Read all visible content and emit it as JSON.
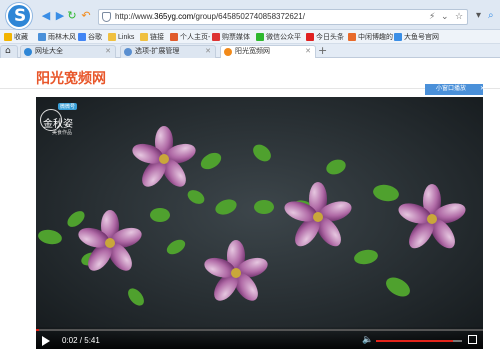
{
  "browser": {
    "url_prefix": "http://www.",
    "url_host": "365yg.com",
    "url_path": "/group/6458502740858372621/",
    "bookmarks": [
      {
        "label": "收藏",
        "color": "#f2b400"
      },
      {
        "label": "雨林木风",
        "color": "#4a90d9"
      },
      {
        "label": "谷歌",
        "color": "#4285f4"
      },
      {
        "label": "Links",
        "color": "#f0c040"
      },
      {
        "label": "链接",
        "color": "#f0c040"
      },
      {
        "label": "个人主页-",
        "color": "#e05a2b"
      },
      {
        "label": "购票媒体",
        "color": "#d33"
      },
      {
        "label": "微信公众平",
        "color": "#2eb82e"
      },
      {
        "label": "今日头条",
        "color": "#e02020"
      },
      {
        "label": "中闲博趣的",
        "color": "#e86a2a"
      },
      {
        "label": "大鱼号官网",
        "color": "#3a8ee6"
      }
    ],
    "tabs": [
      {
        "label": "网址大全",
        "fav": "#2e86d6",
        "active": false
      },
      {
        "label": "选项-扩展管理",
        "fav": "#5a8fd0",
        "active": false
      },
      {
        "label": "阳光宽频网",
        "fav": "#f28a1a",
        "active": true
      }
    ],
    "new_tab": "+"
  },
  "site": {
    "logo_text": "阳光宽频网",
    "mini_player_label": "小窗口播放",
    "mini_close": "✕"
  },
  "video": {
    "channel_badge": "微微号",
    "channel_name": "金秋姿",
    "channel_sub": "美食作品",
    "current_time": "0:02",
    "duration": "5:41",
    "time_sep": " / ",
    "progress_fraction": 0.006,
    "volume_fraction": 0.9,
    "accent": "#e2231a"
  },
  "icons": {
    "back": "back-icon",
    "forward": "forward-icon",
    "refresh": "refresh-icon",
    "undo": "undo-icon"
  }
}
